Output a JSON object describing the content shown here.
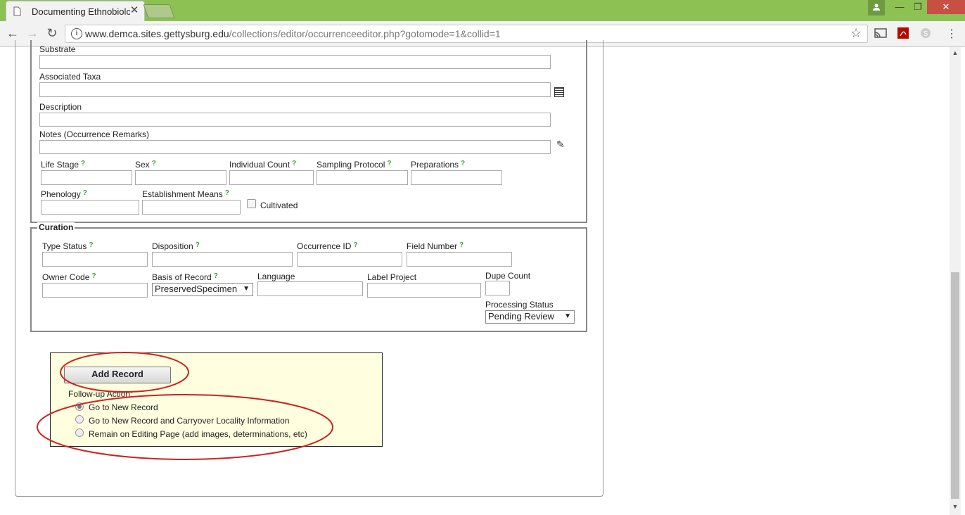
{
  "browser": {
    "tab_title": "Documenting Ethnobiolo",
    "url_host": "www.demca.sites.gettysburg.edu",
    "url_path": "/collections/editor/occurrenceeditor.php?gotomode=1&collid=1",
    "close_glyph": "✕",
    "min_glyph": "—",
    "max_glyph": "❐"
  },
  "misc": {
    "substrate_label": "Substrate",
    "associated_taxa_label": "Associated Taxa",
    "description_label": "Description",
    "notes_label": "Notes (Occurrence Remarks)",
    "life_stage_label": "Life Stage",
    "sex_label": "Sex",
    "individual_count_label": "Individual Count",
    "sampling_protocol_label": "Sampling Protocol",
    "preparations_label": "Preparations",
    "phenology_label": "Phenology",
    "establishment_means_label": "Establishment Means",
    "cultivated_label": "Cultivated",
    "help_mark": "?"
  },
  "curation": {
    "legend": "Curation",
    "type_status_label": "Type Status",
    "disposition_label": "Disposition",
    "occurrence_id_label": "Occurrence ID",
    "field_number_label": "Field Number",
    "owner_code_label": "Owner Code",
    "basis_of_record_label": "Basis of Record",
    "basis_of_record_value": "PreservedSpecimen",
    "language_label": "Language",
    "label_project_label": "Label Project",
    "dupe_count_label": "Dupe Count",
    "processing_status_label": "Processing Status",
    "processing_status_value": "Pending Review"
  },
  "add_record": {
    "button_label": "Add Record",
    "followup_label": "Follow-up Action:",
    "options": [
      {
        "label": "Go to New Record",
        "selected": true
      },
      {
        "label": "Go to New Record and Carryover Locality Information",
        "selected": false
      },
      {
        "label": "Remain on Editing Page (add images, determinations, etc)",
        "selected": false
      }
    ]
  },
  "colors": {
    "titlebar": "#8dc154",
    "panel_bg": "#ffffe0",
    "annotation_ellipse": "#cc2222",
    "help_mark": "#3aa43a"
  }
}
